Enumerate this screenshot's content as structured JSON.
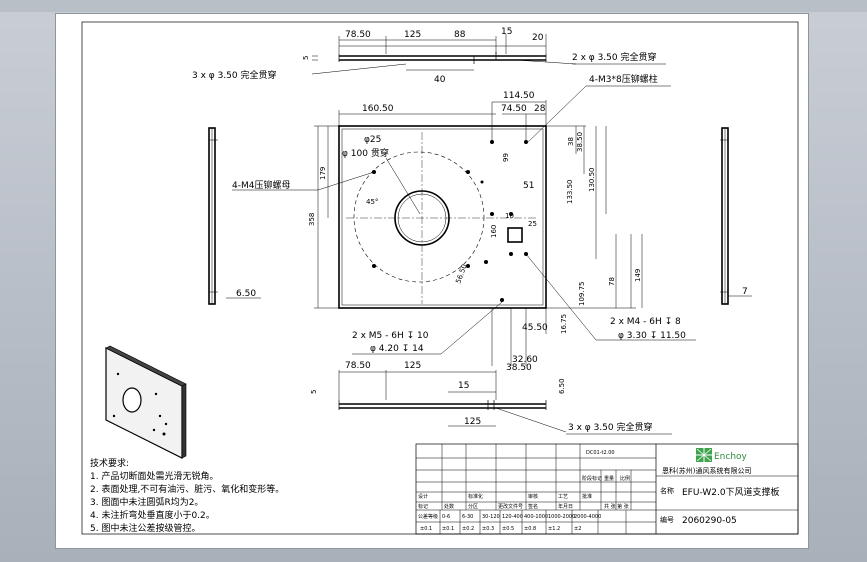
{
  "drawing": {
    "top_view_dims": [
      "78.50",
      "125",
      "88",
      "15",
      "20",
      "40"
    ],
    "note_top": "3 x φ 3.50 完全贯穿",
    "note_right_top": "2 x φ 3.50 完全贯穿",
    "note_studs": "4-M3*8压铆螺柱",
    "note_nuts": "4-M4压铆螺母",
    "main_dims": {
      "w160": "160.50",
      "w114": "114.50",
      "w74": "74.50",
      "w28": "28",
      "d25": "φ25",
      "d100": "φ 100 贯穿",
      "h179": "179",
      "h358": "358",
      "a45": "45°",
      "h99": "99",
      "h38": "38",
      "h38b": "38.50",
      "h133": "133.50",
      "h130": "130.50",
      "w51": "51",
      "h10": "10",
      "h25": "25",
      "h160": "160",
      "h56": "56.50",
      "h109": "109.75",
      "h78": "78",
      "h149": "149",
      "w45": "45.50",
      "h16": "16.75",
      "w32": "32.60",
      "w38": "38.50"
    },
    "note_m5": "2 x M5 - 6H ↧ 10",
    "note_m5_b": "φ 4.20 ↧ 14",
    "note_m4": "2 x M4 - 6H ↧ 8",
    "note_m4_b": "φ 3.30 ↧ 11.50",
    "left_dim": "6.50",
    "right_dim": "7",
    "bottom_view_dims": [
      "78.50",
      "125",
      "15",
      "6.50",
      "125",
      "5"
    ],
    "side_dim_top": "5",
    "side_dim_bottom": "5",
    "note_bottom": "3 x φ 3.50 完全贯穿"
  },
  "tech": {
    "heading": "技术要求:",
    "items": [
      "1. 产品切断面处需光滑无锐角。",
      "2. 表面处理,不可有油污、脏污、氧化和变形等。",
      "3. 图面中未注圆弧R均为2。",
      "4. 未注折弯处垂直度小于0.2。",
      "5. 图中未注公差按级管控。"
    ]
  },
  "title_block": {
    "logo_text": "Enchoy",
    "company": "恩科(苏州)通风系统有限公司",
    "material_code": "DC01-t2.00",
    "part_name_label": "名称",
    "part_name": "EFU-W2.0下风道支撑板",
    "part_no_label": "编号",
    "part_no": "2060290-05",
    "row_labels": [
      "标记",
      "处数",
      "分区",
      "更改文件号",
      "签名",
      "年月日"
    ],
    "sign_labels": [
      "设计",
      "标准化",
      "审核",
      "工艺",
      "批准"
    ],
    "weight_labels": [
      "阶段标记",
      "重量",
      "比例"
    ],
    "sheet_info": "共 张  第 张",
    "tol_row": [
      "公差等级",
      "0-6",
      "6-30",
      "30-120",
      "120-400",
      "400-1000",
      "1000-2000",
      "2000-4000"
    ],
    "tol_vals": [
      "±0.1",
      "±0.1",
      "±0.2",
      "±0.3",
      "±0.5",
      "±0.8",
      "±1.2",
      "±2"
    ]
  }
}
